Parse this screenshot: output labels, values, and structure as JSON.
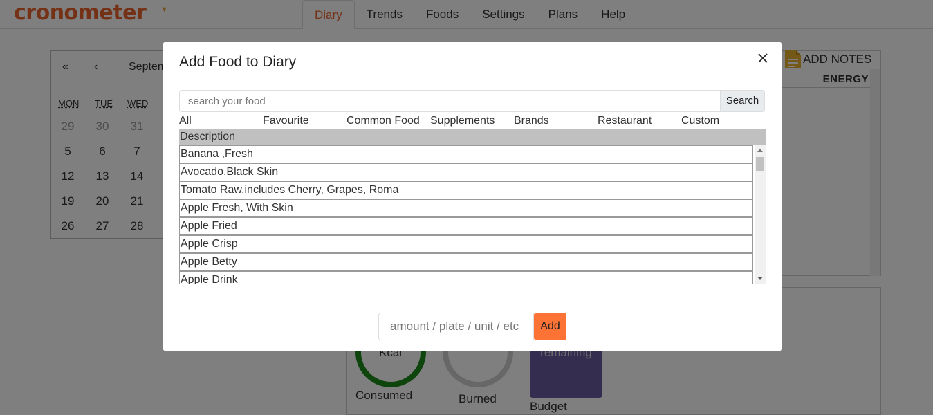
{
  "app": {
    "logo_text": "cronometer",
    "nav": [
      "Diary",
      "Trends",
      "Foods",
      "Settings",
      "Plans",
      "Help"
    ],
    "active_nav": "Diary"
  },
  "calendar": {
    "prev_year": "«",
    "prev_month": "‹",
    "month_label": "Septem",
    "days_of_week": [
      "MON",
      "TUE",
      "WED"
    ],
    "weeks": [
      [
        "29",
        "30",
        "31"
      ],
      [
        "5",
        "6",
        "7"
      ],
      [
        "12",
        "13",
        "14"
      ],
      [
        "19",
        "20",
        "21"
      ],
      [
        "26",
        "27",
        "28"
      ]
    ]
  },
  "side_panel": {
    "add_notes": "ADD NOTES",
    "energy_header": "ENERGY"
  },
  "summary": {
    "consumed_ring": "Kcal",
    "consumed_label": "Consumed",
    "burned_label": "Burned",
    "budget_tile": "remaining",
    "budget_label": "Budget"
  },
  "modal": {
    "title": "Add Food to Diary",
    "search_placeholder": "search your food",
    "search_button": "Search",
    "tabs": [
      "All",
      "Favourite",
      "Common Food",
      "Supplements",
      "Brands",
      "Restaurant",
      "Custom"
    ],
    "list_header": "Description",
    "items": [
      "Banana ,Fresh",
      "Avocado,Black Skin",
      "Tomato Raw,includes Cherry, Grapes, Roma",
      "Apple Fresh, With Skin",
      "Apple Fried",
      "Apple Crisp",
      "Apple Betty",
      "Apple Drink"
    ],
    "amount_placeholder": "amount / plate / unit / etc",
    "add_button": "Add"
  },
  "colors": {
    "brand": "#e8622c",
    "add_button": "#fd7336",
    "consumed_ring": "#1a8a1a",
    "budget_tile": "#6b5aa0"
  }
}
